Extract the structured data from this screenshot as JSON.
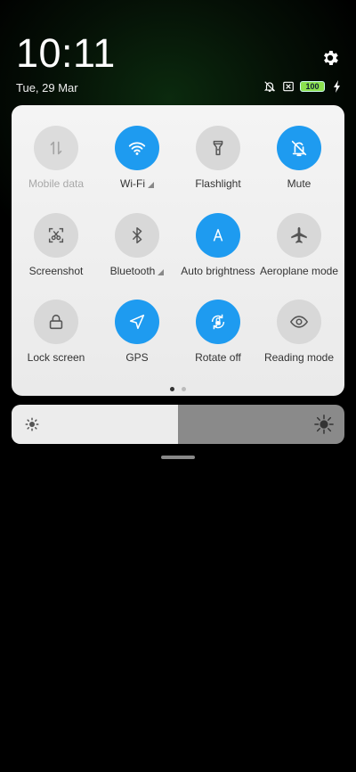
{
  "status": {
    "time": "10:11",
    "date": "Tue, 29 Mar",
    "battery_level": "100",
    "icons": [
      "bell-off-icon",
      "sim-off-icon",
      "battery-icon",
      "charging-bolt-icon"
    ]
  },
  "header": {
    "settings_icon": "gear-icon"
  },
  "quick_settings": {
    "tiles": [
      {
        "label": "Mobile data",
        "icon": "mobile-data-icon",
        "state": "disabled"
      },
      {
        "label": "Wi-Fi",
        "icon": "wifi-icon",
        "state": "on",
        "has_more": true
      },
      {
        "label": "Flashlight",
        "icon": "flashlight-icon",
        "state": "off"
      },
      {
        "label": "Mute",
        "icon": "bell-off-icon",
        "state": "on"
      },
      {
        "label": "Screenshot",
        "icon": "screenshot-icon",
        "state": "off"
      },
      {
        "label": "Bluetooth",
        "icon": "bluetooth-icon",
        "state": "off",
        "has_more": true
      },
      {
        "label": "Auto brightness",
        "icon": "auto-brightness-icon",
        "state": "on"
      },
      {
        "label": "Aeroplane mode",
        "icon": "airplane-icon",
        "state": "off"
      },
      {
        "label": "Lock screen",
        "icon": "lock-icon",
        "state": "off"
      },
      {
        "label": "GPS",
        "icon": "location-arrow-icon",
        "state": "on"
      },
      {
        "label": "Rotate off",
        "icon": "rotate-lock-icon",
        "state": "on"
      },
      {
        "label": "Reading mode",
        "icon": "eye-icon",
        "state": "off"
      }
    ],
    "page_count": 2,
    "current_page": 1
  },
  "brightness": {
    "level": 0.5
  },
  "colors": {
    "accent": "#1e9bf0",
    "panel": "#f0f0f0",
    "battery": "#8BE04E"
  }
}
